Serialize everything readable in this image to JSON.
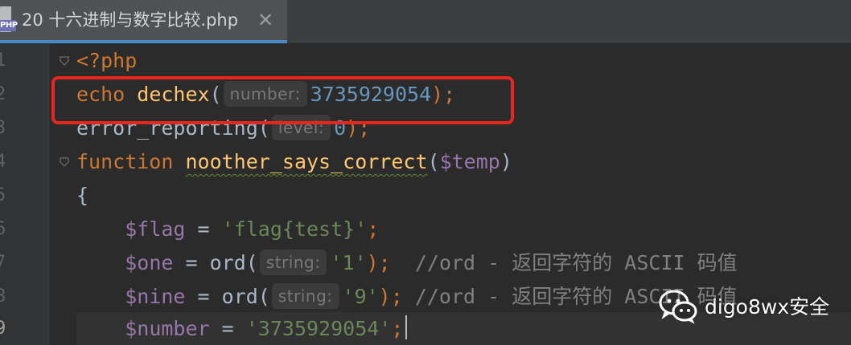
{
  "tab": {
    "badge": "PHP",
    "title": "20 十六进制与数字比较.php",
    "close_glyph": "✕"
  },
  "gutter": {
    "line_numbers": [
      "1",
      "2",
      "3",
      "4",
      "5",
      "6",
      "7",
      "8",
      "9"
    ],
    "current_line": "9"
  },
  "code": {
    "l1": {
      "open_tag": "<?php"
    },
    "l2": {
      "kw": "echo",
      "fn": "dechex",
      "open": "(",
      "hint": "number:",
      "num": "3735929054",
      "close": ");"
    },
    "l3": {
      "fn": "error_reporting",
      "open": "(",
      "hint": "level:",
      "num": "0",
      "close": ");"
    },
    "l4": {
      "kw": "function",
      "name": "noother_says_correct",
      "open": "(",
      "param": "$temp",
      "close": ")"
    },
    "l5": {
      "brace": "{"
    },
    "l6": {
      "var": "$flag",
      "op": " = ",
      "str": "'flag{test}'",
      "end": ";"
    },
    "l7": {
      "var": "$one",
      "op": " = ",
      "fn": "ord",
      "open": "(",
      "hint": "string:",
      "str": "'1'",
      "close": ");",
      "comment": "  //ord - 返回字符的 ASCII 码值"
    },
    "l8": {
      "var": "$nine",
      "op": " = ",
      "fn": "ord",
      "open": "(",
      "hint": "string:",
      "str": "'9'",
      "close": ");",
      "comment": " //ord - 返回字符的 ASCII 码值"
    },
    "l9": {
      "var": "$number",
      "op": " = ",
      "str": "'3735929054'",
      "end": ";"
    }
  },
  "watermark": {
    "text": "digo8wx安全",
    "icon": "wechat-icon"
  },
  "colors": {
    "annotation": "#e6271d",
    "keyword": "#cc7832",
    "function": "#ffc66d",
    "variable": "#9876aa",
    "string": "#6a8759",
    "number": "#6897bb",
    "comment": "#808080"
  }
}
